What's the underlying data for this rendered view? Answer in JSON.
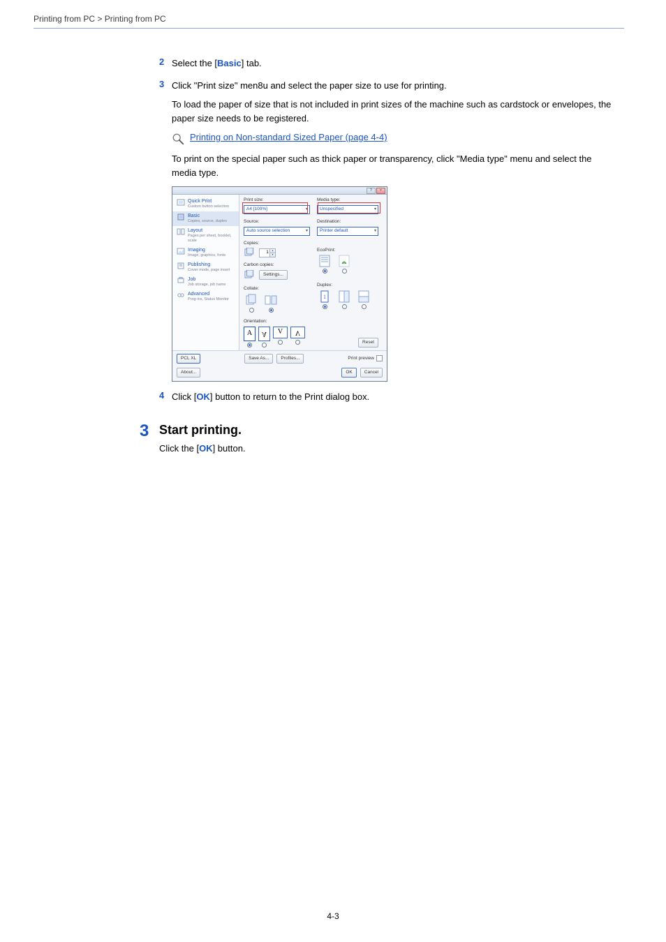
{
  "breadcrumb": "Printing from PC > Printing from PC",
  "steps": {
    "s2_num": "2",
    "s2_a": "Select the [",
    "s2_link": "Basic",
    "s2_b": "] tab.",
    "s3_num": "3",
    "s3_text": "Click \"Print size\" men8u and select the paper size to use for printing.",
    "s3_para": "To load the paper of size that is not included in print sizes of the machine such as cardstock or envelopes, the paper size needs to be registered.",
    "xref": "Printing on Non-standard Sized Paper (page 4-4)",
    "s3_para2": "To print on the special paper such as thick paper or transparency, click \"Media type\" menu and select the media type.",
    "s4_num": "4",
    "s4_a": "Click [",
    "s4_link": "OK",
    "s4_b": "] button to return to the Print dialog box."
  },
  "bigstep": {
    "num": "3",
    "title": "Start printing.",
    "body_a": "Click the [",
    "body_link": "OK",
    "body_b": "] button."
  },
  "dialog": {
    "sidebar": [
      {
        "title": "Quick Print",
        "sub": "Custom button selection"
      },
      {
        "title": "Basic",
        "sub": "Copies, source, duplex"
      },
      {
        "title": "Layout",
        "sub": "Pages per sheet, booklet, scale"
      },
      {
        "title": "Imaging",
        "sub": "Image, graphics, fonts"
      },
      {
        "title": "Publishing",
        "sub": "Cover mode, page insert"
      },
      {
        "title": "Job",
        "sub": "Job storage, job name"
      },
      {
        "title": "Advanced",
        "sub": "Prog-ins, Status Monitor"
      }
    ],
    "labels": {
      "print_size": "Print size:",
      "print_size_val": "A4  [100%]",
      "source": "Source:",
      "source_val": "Auto source selection",
      "copies": "Copies:",
      "copies_val": "1",
      "carbon": "Carbon copies:",
      "settings_btn": "Settings...",
      "collate": "Collate:",
      "orientation": "Orientation:",
      "media_type": "Media type:",
      "media_type_val": "Unspecified",
      "destination": "Destination:",
      "destination_val": "Printer default",
      "ecoprint": "EcoPrint:",
      "duplex": "Duplex:",
      "reset": "Reset",
      "pcl": "PCL XL",
      "save_as": "Save As...",
      "profiles": "Profiles...",
      "print_preview": "Print preview",
      "about": "About...",
      "ok": "OK",
      "cancel": "Cancel"
    }
  },
  "page_number": "4-3"
}
